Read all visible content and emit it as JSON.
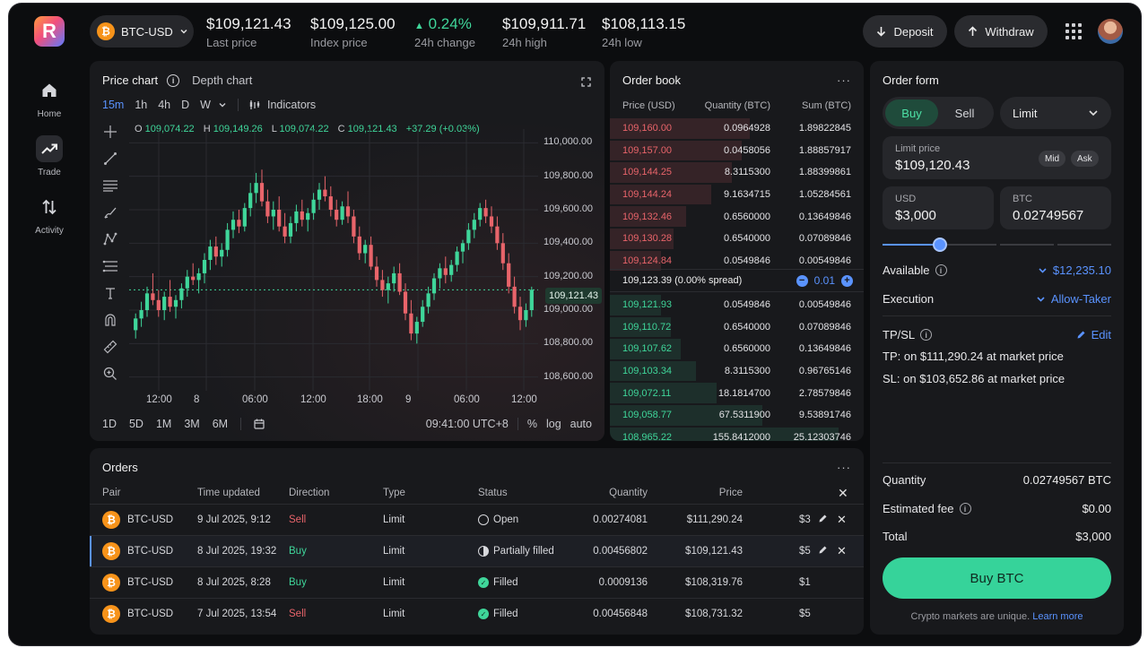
{
  "header": {
    "logo_letter": "R",
    "pair": "BTC-USD",
    "coin_symbol": "₿",
    "stats": [
      {
        "value": "$109,121.43",
        "label": "Last price",
        "trend": ""
      },
      {
        "value": "$109,125.00",
        "label": "Index price",
        "trend": ""
      },
      {
        "value": "0.24%",
        "label": "24h change",
        "trend": "up"
      },
      {
        "value": "$109,911.71",
        "label": "24h high",
        "trend": ""
      },
      {
        "value": "$108,113.15",
        "label": "24h low",
        "trend": ""
      }
    ],
    "deposit_label": "Deposit",
    "withdraw_label": "Withdraw"
  },
  "sidebar": {
    "items": [
      {
        "label": "Home",
        "icon": "home-icon"
      },
      {
        "label": "Trade",
        "icon": "trend-up-icon",
        "active": true
      },
      {
        "label": "Activity",
        "icon": "swap-vertical-icon"
      }
    ]
  },
  "chart": {
    "tab_price": "Price chart",
    "tab_depth": "Depth chart",
    "timeframes": [
      "15m",
      "1h",
      "4h",
      "D",
      "W"
    ],
    "selected_timeframe": "15m",
    "indicators_label": "Indicators",
    "ohlc": {
      "o_label": "O",
      "o": "109,074.22",
      "h_label": "H",
      "h": "109,149.26",
      "l_label": "L",
      "l": "109,074.22",
      "c_label": "C",
      "c": "109,121.43",
      "change": "+37.29 (+0.03%)"
    },
    "y_ticks": [
      "110,000.00",
      "109,800.00",
      "109,600.00",
      "109,400.00",
      "109,200.00",
      "109,000.00",
      "108,800.00",
      "108,600.00"
    ],
    "x_ticks": [
      "12:00",
      "8",
      "06:00",
      "12:00",
      "18:00",
      "9",
      "06:00",
      "12:00"
    ],
    "last_price_tag": "109,121.43",
    "ranges": [
      "1D",
      "5D",
      "1M",
      "3M",
      "6M"
    ],
    "clock": "09:41:00 UTC+8",
    "scale_options": [
      "%",
      "log",
      "auto"
    ],
    "colors": {
      "up": "#3fd69a",
      "down": "#e8646a"
    }
  },
  "chart_data": {
    "type": "candlestick",
    "ylim": [
      108550,
      110050
    ],
    "candles": [
      [
        108880,
        108980,
        108830,
        108950
      ],
      [
        108950,
        109050,
        108900,
        109000
      ],
      [
        109000,
        109140,
        108960,
        109100
      ],
      [
        109100,
        109220,
        109030,
        109060
      ],
      [
        109060,
        109120,
        108960,
        109000
      ],
      [
        109000,
        109110,
        108940,
        109080
      ],
      [
        109080,
        109180,
        108990,
        109020
      ],
      [
        109020,
        109090,
        108950,
        109060
      ],
      [
        109060,
        109160,
        109010,
        109130
      ],
      [
        109130,
        109240,
        109080,
        109200
      ],
      [
        109200,
        109280,
        109150,
        109180
      ],
      [
        109180,
        109250,
        109100,
        109220
      ],
      [
        109220,
        109340,
        109160,
        109300
      ],
      [
        109300,
        109420,
        109240,
        109380
      ],
      [
        109380,
        109440,
        109270,
        109320
      ],
      [
        109320,
        109400,
        109260,
        109360
      ],
      [
        109360,
        109520,
        109320,
        109480
      ],
      [
        109480,
        109590,
        109430,
        109540
      ],
      [
        109540,
        109600,
        109460,
        109500
      ],
      [
        109500,
        109640,
        109470,
        109610
      ],
      [
        109610,
        109760,
        109560,
        109700
      ],
      [
        109700,
        109820,
        109640,
        109760
      ],
      [
        109760,
        109840,
        109620,
        109650
      ],
      [
        109650,
        109720,
        109520,
        109560
      ],
      [
        109560,
        109650,
        109480,
        109600
      ],
      [
        109600,
        109680,
        109470,
        109500
      ],
      [
        109500,
        109580,
        109400,
        109440
      ],
      [
        109440,
        109560,
        109400,
        109520
      ],
      [
        109520,
        109630,
        109470,
        109590
      ],
      [
        109590,
        109660,
        109500,
        109540
      ],
      [
        109540,
        109610,
        109470,
        109580
      ],
      [
        109580,
        109700,
        109540,
        109660
      ],
      [
        109660,
        109760,
        109600,
        109720
      ],
      [
        109720,
        109800,
        109650,
        109680
      ],
      [
        109680,
        109740,
        109560,
        109600
      ],
      [
        109600,
        109660,
        109500,
        109540
      ],
      [
        109540,
        109650,
        109510,
        109620
      ],
      [
        109620,
        109710,
        109520,
        109560
      ],
      [
        109560,
        109600,
        109400,
        109440
      ],
      [
        109440,
        109500,
        109300,
        109340
      ],
      [
        109340,
        109420,
        109280,
        109390
      ],
      [
        109390,
        109440,
        109240,
        109260
      ],
      [
        109260,
        109320,
        109140,
        109180
      ],
      [
        109180,
        109240,
        109080,
        109120
      ],
      [
        109120,
        109200,
        109040,
        109160
      ],
      [
        109160,
        109260,
        109110,
        109220
      ],
      [
        109220,
        109280,
        109090,
        109110
      ],
      [
        109110,
        109160,
        108940,
        108980
      ],
      [
        108980,
        109060,
        108820,
        108860
      ],
      [
        108860,
        108960,
        108800,
        108930
      ],
      [
        108930,
        109060,
        108900,
        109020
      ],
      [
        109020,
        109140,
        108980,
        109100
      ],
      [
        109100,
        109220,
        109060,
        109190
      ],
      [
        109190,
        109280,
        109130,
        109250
      ],
      [
        109250,
        109320,
        109160,
        109210
      ],
      [
        109210,
        109300,
        109170,
        109270
      ],
      [
        109270,
        109380,
        109230,
        109350
      ],
      [
        109350,
        109420,
        109280,
        109400
      ],
      [
        109400,
        109520,
        109360,
        109480
      ],
      [
        109480,
        109580,
        109430,
        109540
      ],
      [
        109540,
        109640,
        109500,
        109610
      ],
      [
        109610,
        109660,
        109520,
        109560
      ],
      [
        109560,
        109620,
        109460,
        109500
      ],
      [
        109500,
        109560,
        109360,
        109400
      ],
      [
        109400,
        109460,
        109240,
        109280
      ],
      [
        109280,
        109340,
        109100,
        109140
      ],
      [
        109140,
        109200,
        108980,
        109020
      ],
      [
        109020,
        109080,
        108880,
        108940
      ],
      [
        108940,
        109040,
        108900,
        109000
      ],
      [
        109000,
        109140,
        108960,
        109121.43
      ]
    ],
    "reference_line": 109121.43
  },
  "orderbook": {
    "title": "Order book",
    "columns": [
      "Price (USD)",
      "Quantity (BTC)",
      "Sum (BTC)"
    ],
    "asks": [
      {
        "price": "109,160.00",
        "qty": "0.0964928",
        "sum": "1.89822845",
        "depth": 0.55
      },
      {
        "price": "109,157.00",
        "qty": "0.0458056",
        "sum": "1.88857917",
        "depth": 0.52
      },
      {
        "price": "109,144.25",
        "qty": "8.3115300",
        "sum": "1.88399861",
        "depth": 0.48
      },
      {
        "price": "109,144.24",
        "qty": "9.1634715",
        "sum": "1.05284561",
        "depth": 0.4
      },
      {
        "price": "109,132.46",
        "qty": "0.6560000",
        "sum": "0.13649846",
        "depth": 0.3
      },
      {
        "price": "109,130.28",
        "qty": "0.6540000",
        "sum": "0.07089846",
        "depth": 0.25
      },
      {
        "price": "109,124.84",
        "qty": "0.0549846",
        "sum": "0.00549846",
        "depth": 0.2
      }
    ],
    "spread": "109,123.39 (0.00% spread)",
    "tick": "0.01",
    "bids": [
      {
        "price": "109,121.93",
        "qty": "0.0549846",
        "sum": "0.00549846",
        "depth": 0.2
      },
      {
        "price": "109,110.72",
        "qty": "0.6540000",
        "sum": "0.07089846",
        "depth": 0.24
      },
      {
        "price": "109,107.62",
        "qty": "0.6560000",
        "sum": "0.13649846",
        "depth": 0.28
      },
      {
        "price": "109,103.34",
        "qty": "8.3115300",
        "sum": "0.96765146",
        "depth": 0.34
      },
      {
        "price": "109,072.11",
        "qty": "18.1814700",
        "sum": "2.78579846",
        "depth": 0.42
      },
      {
        "price": "109,058.77",
        "qty": "67.5311900",
        "sum": "9.53891746",
        "depth": 0.6
      },
      {
        "price": "108,965.22",
        "qty": "155.8412000",
        "sum": "25.12303746",
        "depth": 0.9
      }
    ]
  },
  "order_form": {
    "title": "Order form",
    "buy_label": "Buy",
    "sell_label": "Sell",
    "order_type": "Limit",
    "limit_price_label": "Limit price",
    "limit_price": "$109,120.43",
    "mid_label": "Mid",
    "ask_label": "Ask",
    "usd_label": "USD",
    "usd_value": "$3,000",
    "btc_label": "BTC",
    "btc_value": "0.02749567",
    "slider_percent": 25,
    "available_label": "Available",
    "available_value": "$12,235.10",
    "execution_label": "Execution",
    "execution_value": "Allow-Taker",
    "tpsl_label": "TP/SL",
    "edit_label": "Edit",
    "tp_line": "TP: on $111,290.24 at market price",
    "sl_line": "SL: on $103,652.86 at market price",
    "quantity_label": "Quantity",
    "quantity_value": "0.02749567 BTC",
    "fee_label": "Estimated fee",
    "fee_value": "$0.00",
    "total_label": "Total",
    "total_value": "$3,000",
    "submit_label": "Buy BTC",
    "disclaimer": "Crypto markets are unique.",
    "learn_more": "Learn more"
  },
  "orders": {
    "title": "Orders",
    "columns": [
      "Pair",
      "Time updated",
      "Direction",
      "Type",
      "Status",
      "Quantity",
      "Price"
    ],
    "rows": [
      {
        "pair": "BTC-USD",
        "time": "9 Jul 2025, 9:12",
        "direction": "Sell",
        "type": "Limit",
        "status": "Open",
        "qty": "0.00274081",
        "price": "$111,290.24",
        "extra": "$3",
        "editable": true
      },
      {
        "pair": "BTC-USD",
        "time": "8 Jul 2025, 19:32",
        "direction": "Buy",
        "type": "Limit",
        "status": "Partially filled",
        "qty": "0.00456802",
        "price": "$109,121.43",
        "extra": "$5",
        "editable": true
      },
      {
        "pair": "BTC-USD",
        "time": "8 Jul 2025, 8:28",
        "direction": "Buy",
        "type": "Limit",
        "status": "Filled",
        "qty": "0.0009136",
        "price": "$108,319.76",
        "extra": "$1",
        "editable": false
      },
      {
        "pair": "BTC-USD",
        "time": "7 Jul 2025, 13:54",
        "direction": "Sell",
        "type": "Limit",
        "status": "Filled",
        "qty": "0.00456848",
        "price": "$108,731.32",
        "extra": "$5",
        "editable": false
      }
    ]
  }
}
